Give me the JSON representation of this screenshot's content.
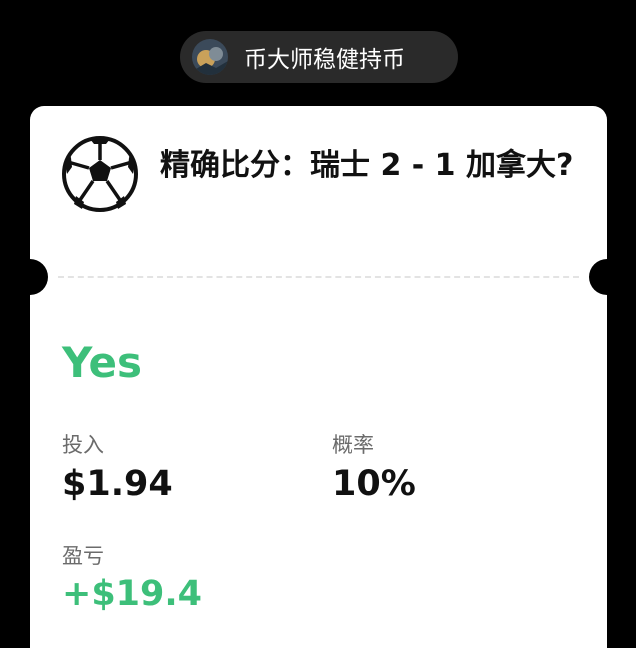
{
  "user": {
    "name": "币大师稳健持币",
    "avatar_icon": "avatar-image"
  },
  "market": {
    "icon": "soccer-ball-icon",
    "title": "精确比分：瑞士 2 - 1 加拿大?"
  },
  "position": {
    "outcome": "Yes",
    "invest_label": "投入",
    "invest_value": "$1.94",
    "probability_label": "概率",
    "probability_value": "10%",
    "pnl_label": "盈亏",
    "pnl_value": "+$19.4"
  },
  "colors": {
    "background": "#000000",
    "card": "#ffffff",
    "accent_green": "#3dbf7a",
    "pill": "#2a2a2a"
  }
}
